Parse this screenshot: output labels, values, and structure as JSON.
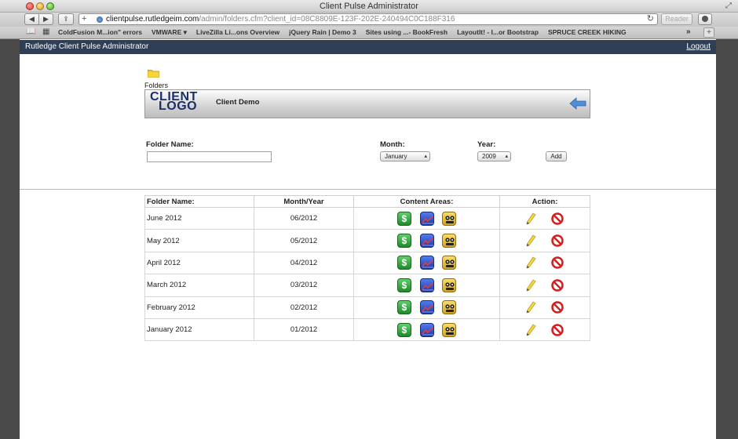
{
  "window": {
    "title": "Client Pulse Administrator"
  },
  "browser": {
    "url_host": "clientpulse.rutledgeim.com",
    "url_path": "/admin/folders.cfm?client_id=08C8809E-123F-202E-240494C0C188F316",
    "reader_label": "Reader",
    "bookmarks": [
      "ColdFusion M...ion\" errors",
      "VMWARE ▾",
      "LiveZilla Li...ons Overview",
      "jQuery Rain | Demo 3",
      "Sites using ...- BookFresh",
      "LayoutIt! - I...or Bootstrap",
      "SPRUCE CREEK HIKING"
    ]
  },
  "header": {
    "title": "Rutledge Client Pulse Administrator",
    "logout": "Logout"
  },
  "breadcrumb": {
    "label": "Folders"
  },
  "client": {
    "logo_line1": "CLIENT",
    "logo_line2": "LOGO",
    "name": "Client Demo"
  },
  "form": {
    "folder_name_label": "Folder Name:",
    "folder_name_value": "",
    "month_label": "Month:",
    "month_value": "January",
    "year_label": "Year:",
    "year_value": "2009",
    "add_label": "Add"
  },
  "table": {
    "headers": {
      "name": "Folder Name:",
      "month_year": "Month/Year",
      "content_areas": "Content Areas:",
      "action": "Action:"
    },
    "rows": [
      {
        "name": "June 2012",
        "month_year": "06/2012"
      },
      {
        "name": "May 2012",
        "month_year": "05/2012"
      },
      {
        "name": "April 2012",
        "month_year": "04/2012"
      },
      {
        "name": "March 2012",
        "month_year": "03/2012"
      },
      {
        "name": "February 2012",
        "month_year": "02/2012"
      },
      {
        "name": "January 2012",
        "month_year": "01/2012"
      }
    ]
  },
  "icons": {
    "money": "dollar-icon",
    "chart": "line-chart-icon",
    "people": "people-icon",
    "edit": "pencil-icon",
    "delete": "no-entry-icon"
  },
  "colors": {
    "header_bg": "#2d3e55",
    "logo_text": "#1a2f6a",
    "delete_red": "#d51f1f"
  }
}
